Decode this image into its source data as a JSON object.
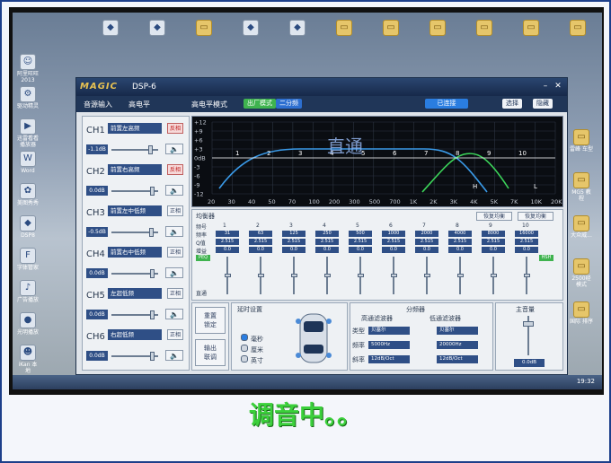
{
  "desktop": {
    "left_icons": [
      {
        "label": "阿里旺旺 2013",
        "icon": "chat-icon"
      },
      {
        "label": "驱动精灵",
        "icon": "driver-icon"
      },
      {
        "label": "迅雷看看 播放器",
        "icon": "video-icon"
      },
      {
        "label": "Word",
        "icon": "word-icon"
      },
      {
        "label": "美图秀秀",
        "icon": "photo-icon"
      },
      {
        "label": "DSP8",
        "icon": "app-icon"
      },
      {
        "label": "字体管家",
        "icon": "font-icon"
      },
      {
        "label": "广告播放",
        "icon": "music-icon"
      },
      {
        "label": "光明播放",
        "icon": "media-icon"
      },
      {
        "label": "iKan 本地",
        "icon": "user-icon"
      }
    ],
    "top_icons": [
      "app-icon",
      "app-icon",
      "folder-icon",
      "app-icon",
      "app-icon",
      "folder-icon",
      "folder-icon",
      "folder-icon",
      "folder-icon",
      "folder-icon",
      "folder-icon"
    ],
    "right_icons": [
      "雷峰 车型",
      "MG5 教程",
      "大众威...",
      "2500经 模式",
      "国际 排序"
    ],
    "clock": "19:32"
  },
  "window": {
    "logo": "MAGIC",
    "model": "DSP-6",
    "menu_audio_input": "音源输入",
    "menu_level": "高电平",
    "mode_label": "高电平模式",
    "btn_factory": "出厂模式",
    "btn_open": "已连接",
    "btn_select": "选择",
    "btn_exit": "隐藏",
    "close_glyph": "✕",
    "min_glyph": "–"
  },
  "channels": [
    {
      "name": "CH1",
      "source": "前置左高频",
      "btn": "反相",
      "value": "-1.1dB",
      "level": 0.85,
      "red": true
    },
    {
      "name": "CH2",
      "source": "前置右高频",
      "btn": "反相",
      "value": "0.0dB",
      "level": 0.9,
      "red": true
    },
    {
      "name": "CH3",
      "source": "前置左中低频",
      "btn": "正相",
      "value": "-0.5dB",
      "level": 0.88,
      "red": false
    },
    {
      "name": "CH4",
      "source": "前置右中低频",
      "btn": "正相",
      "value": "0.0dB",
      "level": 0.9,
      "red": false
    },
    {
      "name": "CH5",
      "source": "左超低频",
      "btn": "正相",
      "value": "0.0dB",
      "level": 0.9,
      "red": false
    },
    {
      "name": "CH6",
      "source": "右超低频",
      "btn": "正相",
      "value": "0.0dB",
      "level": 0.9,
      "red": false
    }
  ],
  "graph": {
    "overlay_text": "直通",
    "y_ticks": [
      "+12",
      "+9",
      "+6",
      "+3",
      "0dB",
      "-3",
      "-6",
      "-9",
      "-12"
    ],
    "x_ticks": [
      "20",
      "30",
      "40",
      "50",
      "70",
      "100",
      "200",
      "300",
      "500",
      "700",
      "1K",
      "2K",
      "3K",
      "4K",
      "5K",
      "7K",
      "10K",
      "20K"
    ],
    "band_markers": [
      "1",
      "2",
      "3",
      "4",
      "5",
      "6",
      "7",
      "8",
      "9",
      "10"
    ],
    "marker_h": "H",
    "marker_l": "L"
  },
  "eq": {
    "title": "均衡器",
    "btn_reset": "恢复均衡",
    "btn_copy": "恢复均衡",
    "row_labels": [
      "频号",
      "频率",
      "Q值",
      "增益"
    ],
    "bands": [
      {
        "n": "1",
        "freq": "31",
        "q": "2.515",
        "gain": "0.0",
        "level": 0.5
      },
      {
        "n": "2",
        "freq": "63",
        "q": "2.515",
        "gain": "0.0",
        "level": 0.5
      },
      {
        "n": "3",
        "freq": "125",
        "q": "2.515",
        "gain": "0.0",
        "level": 0.5
      },
      {
        "n": "4",
        "freq": "250",
        "q": "2.515",
        "gain": "0.0",
        "level": 0.5
      },
      {
        "n": "5",
        "freq": "500",
        "q": "2.515",
        "gain": "0.0",
        "level": 0.5
      },
      {
        "n": "6",
        "freq": "1000",
        "q": "2.515",
        "gain": "0.0",
        "level": 0.5
      },
      {
        "n": "7",
        "freq": "2000",
        "q": "2.515",
        "gain": "0.0",
        "level": 0.5
      },
      {
        "n": "8",
        "freq": "4000",
        "q": "2.515",
        "gain": "0.0",
        "level": 0.5
      },
      {
        "n": "9",
        "freq": "8000",
        "q": "2.515",
        "gain": "0.0",
        "level": 0.5
      },
      {
        "n": "10",
        "freq": "16000",
        "q": "2.515",
        "gain": "0.0",
        "level": 0.5
      }
    ],
    "peq_label": "PEQ",
    "lsh_label": "LSH",
    "hsh_label": "HSH",
    "direct_label": "直通"
  },
  "bottom": {
    "btn_restore": "重置\n锁定",
    "btn_output": "输出\n联调",
    "delay_title": "延时设置",
    "units": [
      "毫秒",
      "厘米",
      "英寸"
    ],
    "xover_title": "分频器",
    "hp_title": "高通滤波器",
    "lp_title": "低通滤波器",
    "type_label": "类型",
    "freq_label": "频率",
    "slope_label": "斜率",
    "hp_type": "贝塞尔",
    "lp_type": "贝塞尔",
    "hp_freq": "5000Hz",
    "lp_freq": "20000Hz",
    "hp_slope": "12dB/Oct",
    "lp_slope": "12dB/Oct",
    "master_title": "主音量",
    "master_value": "0.0dB"
  },
  "caption": "调音中。。"
}
